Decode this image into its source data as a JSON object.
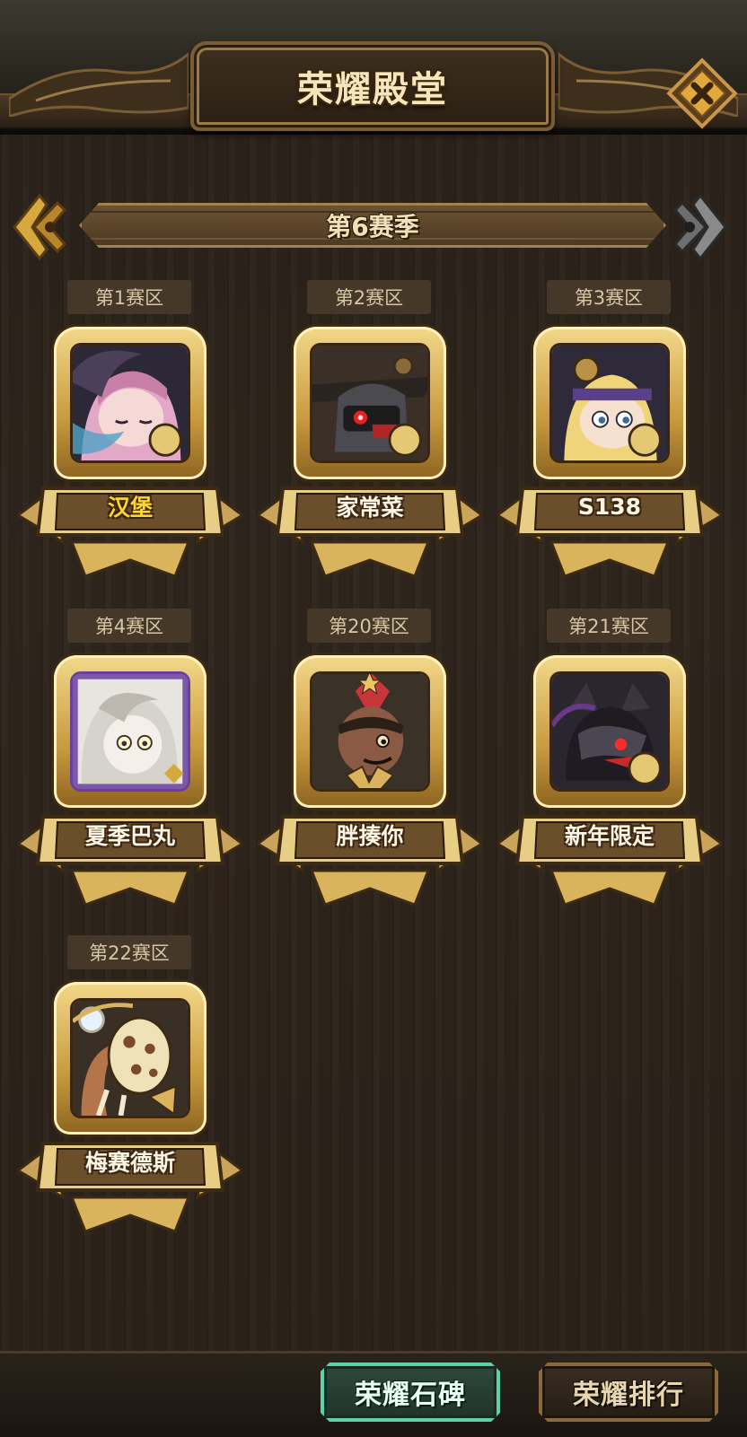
{
  "header": {
    "title": "荣耀殿堂",
    "close_icon": "close-x-icon"
  },
  "season": {
    "label": "第6赛季",
    "prev_icon": "left-arrow-icon",
    "next_icon": "right-arrow-icon"
  },
  "regions": [
    {
      "tag": "第1赛区",
      "name": "汉堡",
      "name_highlight": true,
      "portrait": "pink-hair-character-portrait"
    },
    {
      "tag": "第2赛区",
      "name": "家常菜",
      "name_highlight": false,
      "portrait": "dark-knight-red-eye-portrait"
    },
    {
      "tag": "第3赛区",
      "name": "S138",
      "name_highlight": false,
      "portrait": "blonde-headband-character-portrait"
    },
    {
      "tag": "第4赛区",
      "name": "夏季巴丸",
      "name_highlight": false,
      "portrait": "white-hair-character-portrait"
    },
    {
      "tag": "第20赛区",
      "name": "胖揍你",
      "name_highlight": false,
      "portrait": "red-mohawk-character-portrait"
    },
    {
      "tag": "第21赛区",
      "name": "新年限定",
      "name_highlight": false,
      "portrait": "dark-wolf-character-portrait"
    },
    {
      "tag": "第22赛区",
      "name": "梅赛德斯",
      "name_highlight": false,
      "portrait": "cookie-mask-character-portrait"
    }
  ],
  "bottom": {
    "stele_label": "荣耀石碑",
    "rank_label": "荣耀排行"
  },
  "colors": {
    "gold": "#d9b45c",
    "highlight_name": "#ffd62b",
    "stele_accent": "#5fd1a8"
  }
}
